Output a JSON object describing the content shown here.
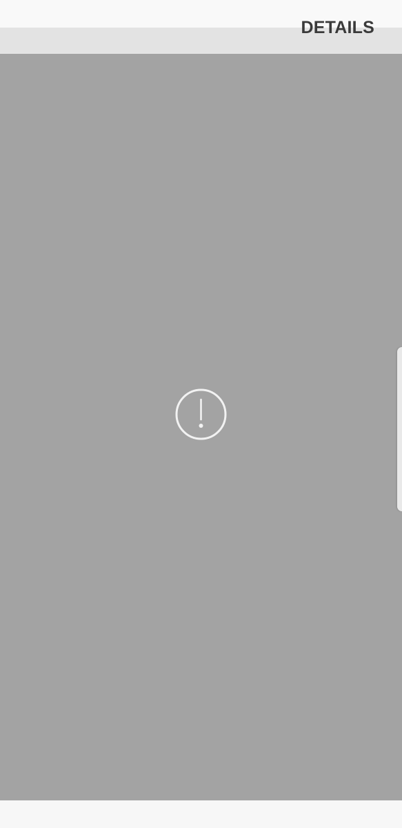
{
  "header": {
    "details_label": "DETAILS"
  },
  "content": {
    "status_icon": "exclamation-circle-icon",
    "background_color": "#a3a3a3",
    "icon_color": "#f2f2f2"
  },
  "edge_panel": {
    "icon": "edge-panel-handle"
  }
}
